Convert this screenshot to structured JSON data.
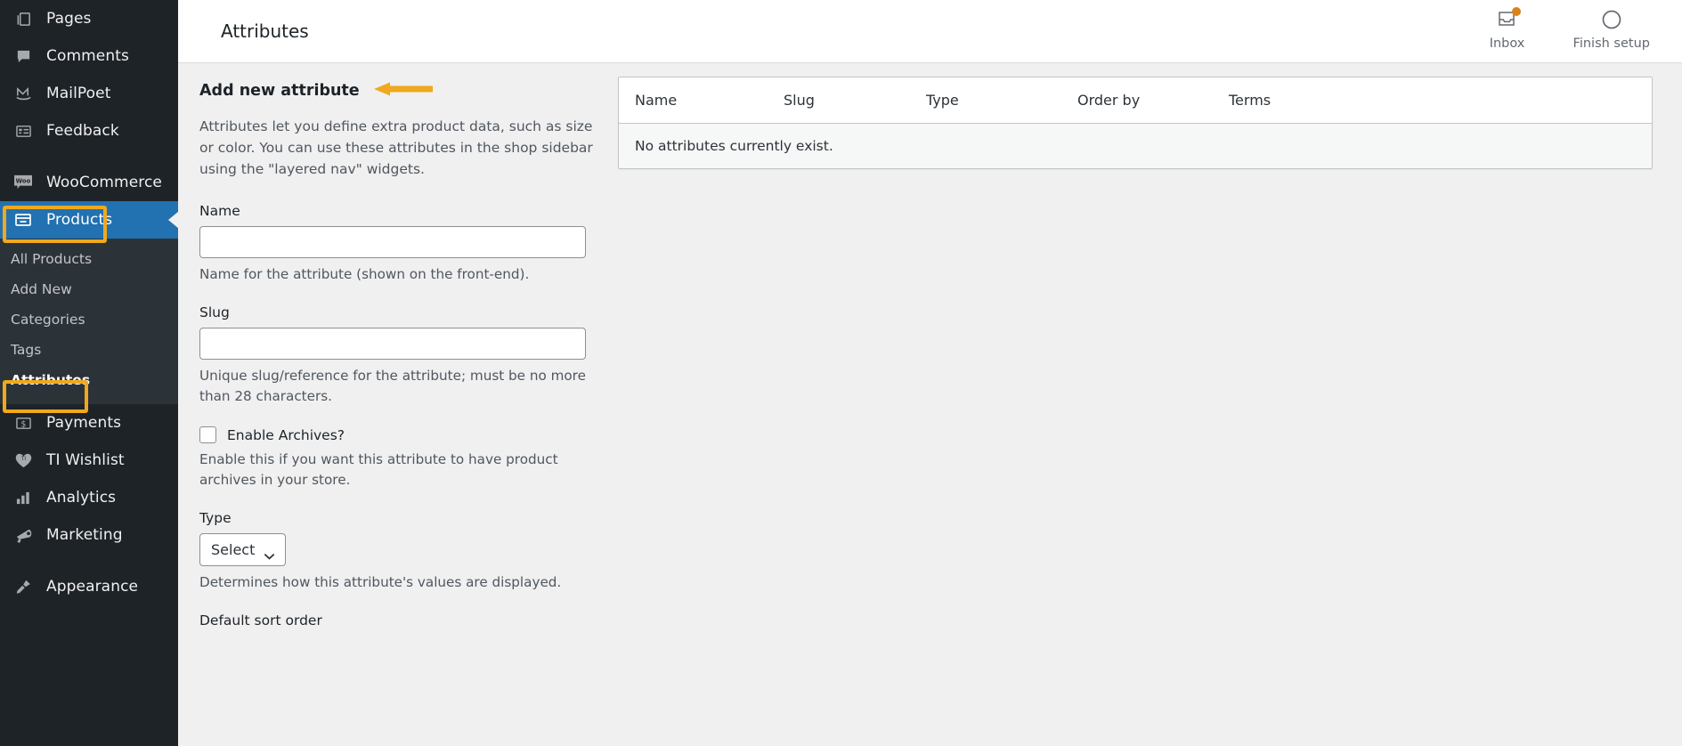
{
  "sidebar": {
    "items": [
      {
        "label": "Pages",
        "icon": "pages-icon"
      },
      {
        "label": "Comments",
        "icon": "comments-icon"
      },
      {
        "label": "MailPoet",
        "icon": "mailpoet-icon"
      },
      {
        "label": "Feedback",
        "icon": "feedback-icon"
      },
      {
        "label": "WooCommerce",
        "icon": "woocommerce-icon"
      },
      {
        "label": "Products",
        "icon": "products-icon"
      },
      {
        "label": "Payments",
        "icon": "payments-icon"
      },
      {
        "label": "TI Wishlist",
        "icon": "wishlist-heart-icon"
      },
      {
        "label": "Analytics",
        "icon": "analytics-icon"
      },
      {
        "label": "Marketing",
        "icon": "marketing-megaphone-icon"
      },
      {
        "label": "Appearance",
        "icon": "appearance-brush-icon"
      }
    ],
    "submenu": [
      {
        "label": "All Products"
      },
      {
        "label": "Add New"
      },
      {
        "label": "Categories"
      },
      {
        "label": "Tags"
      },
      {
        "label": "Attributes"
      }
    ],
    "active_item": "Products",
    "active_submenu": "Attributes",
    "highlight_color": "#f0a81e",
    "current_bg": "#2271b1",
    "bg": "#1d2327"
  },
  "topbar": {
    "title": "Attributes",
    "actions": [
      {
        "label": "Inbox",
        "icon": "inbox-tray-icon",
        "has_notification": true
      },
      {
        "label": "Finish setup",
        "icon": "circle-progress-icon",
        "has_notification": false
      }
    ],
    "notification_color": "#d9821a"
  },
  "form": {
    "heading": "Add new attribute",
    "annotation_arrow": "left-pointing-arrow",
    "description": "Attributes let you define extra product data, such as size or color. You can use these attributes in the shop sidebar using the \"layered nav\" widgets.",
    "name_label": "Name",
    "name_value": "",
    "name_placeholder": "",
    "name_help": "Name for the attribute (shown on the front-end).",
    "slug_label": "Slug",
    "slug_value": "",
    "slug_placeholder": "",
    "slug_help": "Unique slug/reference for the attribute; must be no more than 28 characters.",
    "archives_label": "Enable Archives?",
    "archives_checked": false,
    "archives_help": "Enable this if you want this attribute to have product archives in your store.",
    "type_label": "Type",
    "type_value": "Select",
    "type_help": "Determines how this attribute's values are displayed.",
    "sort_label": "Default sort order"
  },
  "table": {
    "columns": [
      "Name",
      "Slug",
      "Type",
      "Order by",
      "Terms"
    ],
    "empty_message": "No attributes currently exist.",
    "rows": []
  }
}
